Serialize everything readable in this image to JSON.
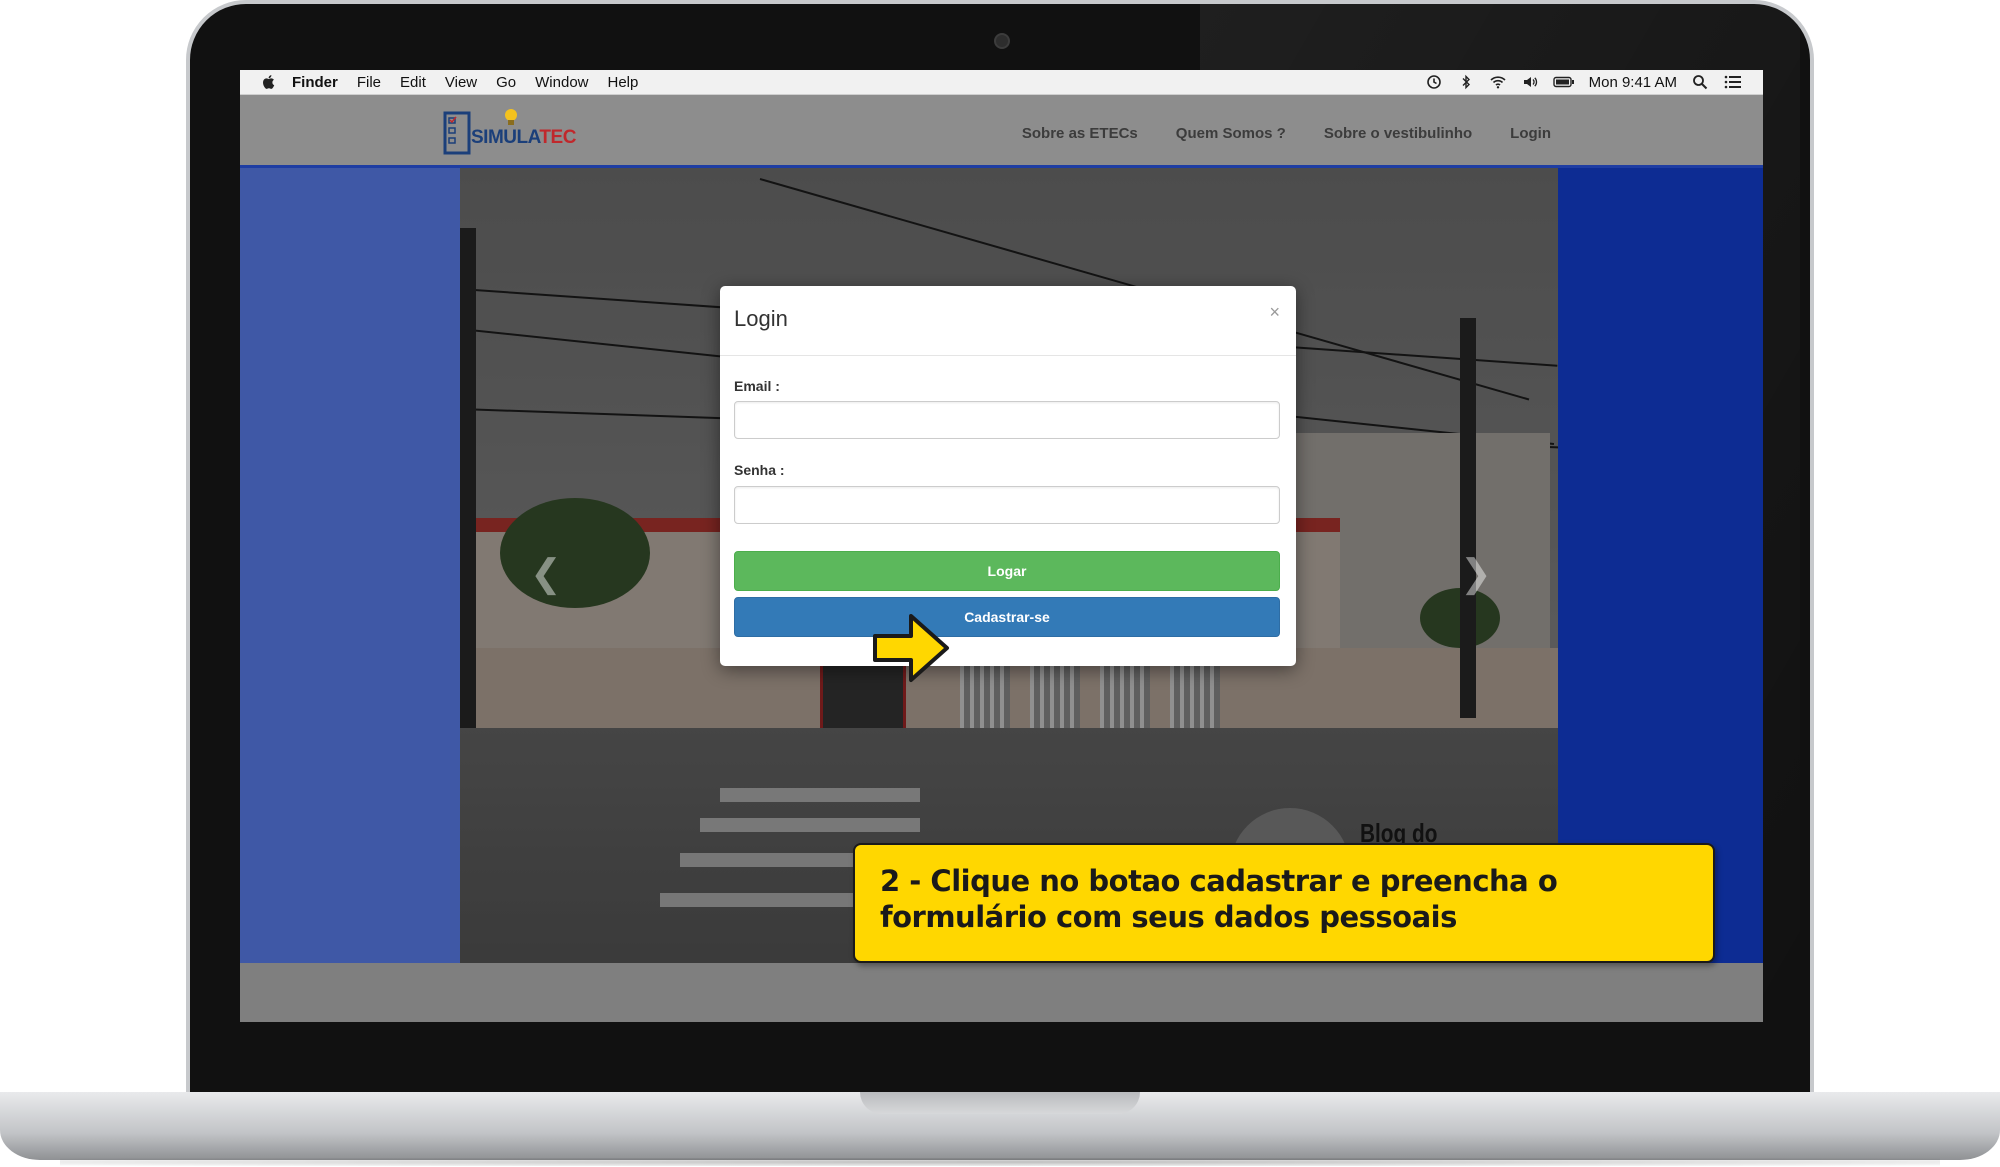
{
  "menubar": {
    "app_name": "Finder",
    "items": [
      "File",
      "Edit",
      "View",
      "Go",
      "Window",
      "Help"
    ],
    "clock": "Mon 9:41 AM",
    "status_icons": [
      "time-machine-icon",
      "bluetooth-icon",
      "wifi-icon",
      "volume-icon",
      "battery-icon",
      "spotlight-icon",
      "notification-center-icon"
    ]
  },
  "site": {
    "logo": {
      "part1": "SIMULA",
      "part2": "TEC"
    },
    "nav": [
      "Sobre as ETECs",
      "Quem Somos ?",
      "Sobre o vestibulinho",
      "Login"
    ],
    "hero_caption": "Blog do"
  },
  "modal": {
    "title": "Login",
    "close_symbol": "×",
    "email_label": "Email :",
    "email_value": "",
    "password_label": "Senha :",
    "password_value": "",
    "login_button": "Logar",
    "register_button": "Cadastrar-se"
  },
  "callout": {
    "text": "2 - Clique no botao cadastrar e preencha o formulário com seus dados pessoais"
  },
  "colors": {
    "navbar": "#8d8d8d",
    "site_blue": "#0d2c93",
    "login_green": "#5cb85c",
    "register_blue": "#337ab7",
    "callout_yellow": "#ffd700",
    "arrow_yellow": "#ffd700"
  }
}
